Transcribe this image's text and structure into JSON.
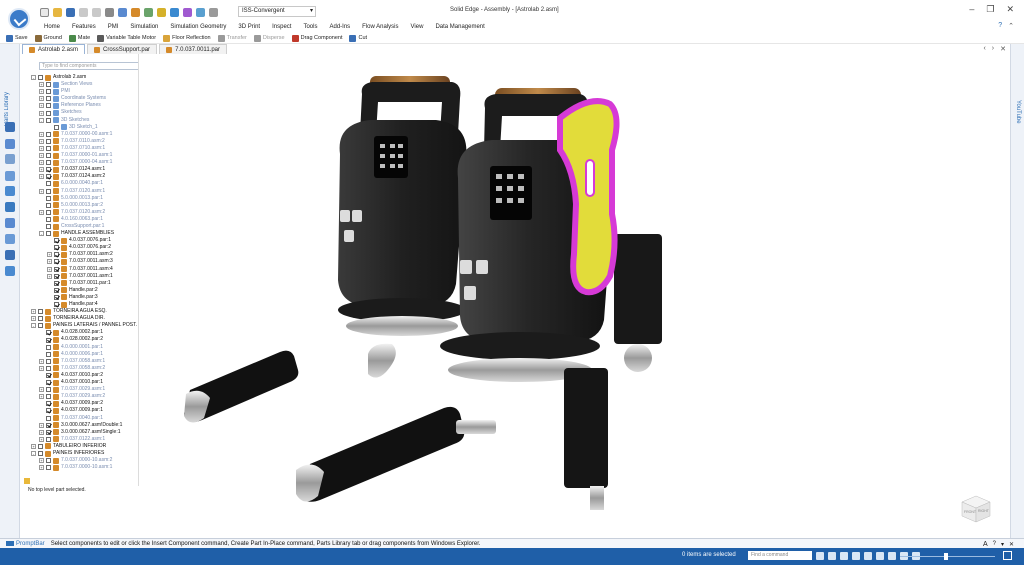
{
  "window": {
    "title": "Solid Edge - Assembly - [Astrolab 2.asm]",
    "environment": "ISS-Convergent"
  },
  "ribbon": {
    "tabs": [
      "Home",
      "Features",
      "PMI",
      "Simulation",
      "Simulation Geometry",
      "3D Print",
      "Inspect",
      "Tools",
      "Add-Ins",
      "Flow Analysis",
      "View",
      "Data Management"
    ]
  },
  "commandbar": {
    "items": [
      {
        "label": "Save",
        "color": "#3a6fb5",
        "disabled": false
      },
      {
        "label": "Ground",
        "color": "#8a6a3a",
        "disabled": false
      },
      {
        "label": "Mate",
        "color": "#4a8a4a",
        "disabled": false
      },
      {
        "label": "Variable Table Motor",
        "color": "#5a5a5a",
        "disabled": false
      },
      {
        "label": "Floor Reflection",
        "color": "#d9a43a",
        "disabled": false
      },
      {
        "label": "Transfer",
        "color": "#9a9a9a",
        "disabled": true
      },
      {
        "label": "Disperse",
        "color": "#9a9a9a",
        "disabled": true
      },
      {
        "label": "Drag Component",
        "color": "#c0392b",
        "disabled": false
      },
      {
        "label": "Cut",
        "color": "#3a6fb5",
        "disabled": false
      }
    ]
  },
  "doctabs": [
    {
      "label": "Astrolab 2.asm",
      "active": true
    },
    {
      "label": "CrossSupport.par",
      "active": false
    },
    {
      "label": "7.0.037.0011.par",
      "active": false
    }
  ],
  "sidebar": {
    "parts_library_label": "Parts Library",
    "youtube_label": "YouTube"
  },
  "pathfinder": {
    "search_placeholder": "Type to find components",
    "status": "No top level part selected.",
    "rows": [
      {
        "indent": 0,
        "exp": "-",
        "cb": false,
        "label": "Astrolab 2.asm",
        "icon": "#d58a2a",
        "style": "group"
      },
      {
        "indent": 1,
        "exp": "+",
        "cb": false,
        "label": "Section Views",
        "icon": "#6a9ad6",
        "style": "dim"
      },
      {
        "indent": 1,
        "exp": "+",
        "cb": false,
        "label": "PMI",
        "icon": "#6a9ad6",
        "style": "dim"
      },
      {
        "indent": 1,
        "exp": "+",
        "cb": false,
        "label": "Coordinate Systems",
        "icon": "#6a9ad6",
        "style": "dim"
      },
      {
        "indent": 1,
        "exp": "+",
        "cb": false,
        "label": "Reference Planes",
        "icon": "#6a9ad6",
        "style": "dim"
      },
      {
        "indent": 1,
        "exp": "+",
        "cb": false,
        "label": "Sketches",
        "icon": "#6a9ad6",
        "style": "dim"
      },
      {
        "indent": 1,
        "exp": "-",
        "cb": false,
        "label": "3D Sketches",
        "icon": "#6a9ad6",
        "style": "dim"
      },
      {
        "indent": 2,
        "exp": "",
        "cb": false,
        "label": "3D Sketch_1",
        "icon": "#6a9ad6",
        "style": "dim"
      },
      {
        "indent": 1,
        "exp": "+",
        "cb": false,
        "label": "7.0.037.0000-00.asm:1",
        "icon": "#d58a2a",
        "style": "dim"
      },
      {
        "indent": 1,
        "exp": "+",
        "cb": false,
        "label": "7.0.037.0110.asm:2",
        "icon": "#d58a2a",
        "style": "dim"
      },
      {
        "indent": 1,
        "exp": "+",
        "cb": false,
        "label": "7.0.037.0710.asm:1",
        "icon": "#d58a2a",
        "style": "dim"
      },
      {
        "indent": 1,
        "exp": "+",
        "cb": false,
        "label": "7.0.037.0000-01.asm:1",
        "icon": "#d58a2a",
        "style": "dim"
      },
      {
        "indent": 1,
        "exp": "+",
        "cb": false,
        "label": "7.0.037.0000-04.asm:1",
        "icon": "#d58a2a",
        "style": "dim"
      },
      {
        "indent": 1,
        "exp": "+",
        "cb": true,
        "label": "7.0.037.0124.asm:1",
        "icon": "#d58a2a",
        "style": "normal"
      },
      {
        "indent": 1,
        "exp": "+",
        "cb": true,
        "label": "7.0.037.0124.asm:2",
        "icon": "#d58a2a",
        "style": "normal"
      },
      {
        "indent": 1,
        "exp": "",
        "cb": false,
        "label": "6.0.000.0040.par:1",
        "icon": "#d58a2a",
        "style": "dim"
      },
      {
        "indent": 1,
        "exp": "+",
        "cb": false,
        "label": "7.0.037.0120.asm:1",
        "icon": "#d58a2a",
        "style": "dim"
      },
      {
        "indent": 1,
        "exp": "",
        "cb": false,
        "label": "5.0.000.0013.par:1",
        "icon": "#d58a2a",
        "style": "dim"
      },
      {
        "indent": 1,
        "exp": "",
        "cb": false,
        "label": "5.0.000.0013.par:2",
        "icon": "#d58a2a",
        "style": "dim"
      },
      {
        "indent": 1,
        "exp": "+",
        "cb": false,
        "label": "7.0.037.0120.asm:2",
        "icon": "#d58a2a",
        "style": "dim"
      },
      {
        "indent": 1,
        "exp": "",
        "cb": false,
        "label": "4.0.160.0063.par:1",
        "icon": "#d58a2a",
        "style": "dim"
      },
      {
        "indent": 1,
        "exp": "",
        "cb": false,
        "label": "CrossSupport.par:1",
        "icon": "#d58a2a",
        "style": "dim"
      },
      {
        "indent": 1,
        "exp": "-",
        "cb": false,
        "label": "HANDLE ASSEMBLIES",
        "icon": "#d58a2a",
        "style": "group"
      },
      {
        "indent": 2,
        "exp": "",
        "cb": true,
        "label": "4.0.037.0076.par:1",
        "icon": "#d58a2a",
        "style": "normal"
      },
      {
        "indent": 2,
        "exp": "",
        "cb": true,
        "label": "4.0.037.0076.par:2",
        "icon": "#d58a2a",
        "style": "normal"
      },
      {
        "indent": 2,
        "exp": "+",
        "cb": true,
        "label": "7.0.037.0011.asm:2",
        "icon": "#d58a2a",
        "style": "normal"
      },
      {
        "indent": 2,
        "exp": "+",
        "cb": true,
        "label": "7.0.037.0011.asm:3",
        "icon": "#d58a2a",
        "style": "normal"
      },
      {
        "indent": 2,
        "exp": "+",
        "cb": true,
        "label": "7.0.037.0011.asm:4",
        "icon": "#d58a2a",
        "style": "normal"
      },
      {
        "indent": 2,
        "exp": "+",
        "cb": true,
        "label": "7.0.037.0011.asm:1",
        "icon": "#d58a2a",
        "style": "normal"
      },
      {
        "indent": 2,
        "exp": "",
        "cb": true,
        "label": "7.0.037.0011.par:1",
        "icon": "#d58a2a",
        "style": "normal"
      },
      {
        "indent": 2,
        "exp": "",
        "cb": true,
        "label": "Handle.par:2",
        "icon": "#d58a2a",
        "style": "normal"
      },
      {
        "indent": 2,
        "exp": "",
        "cb": true,
        "label": "Handle.par:3",
        "icon": "#d58a2a",
        "style": "normal"
      },
      {
        "indent": 2,
        "exp": "",
        "cb": true,
        "label": "Handle.par:4",
        "icon": "#d58a2a",
        "style": "normal"
      },
      {
        "indent": 0,
        "exp": "+",
        "cb": false,
        "label": "TORNEIRA AGUA ESQ.",
        "icon": "#d58a2a",
        "style": "group"
      },
      {
        "indent": 0,
        "exp": "+",
        "cb": false,
        "label": "TORNEIRA AGUA DIR.",
        "icon": "#d58a2a",
        "style": "group"
      },
      {
        "indent": 0,
        "exp": "-",
        "cb": false,
        "label": "PAINEIS LATERAIS / PANNEL POST.",
        "icon": "#d58a2a",
        "style": "group"
      },
      {
        "indent": 1,
        "exp": "",
        "cb": true,
        "label": "4.0.028.0002.par:1",
        "icon": "#d58a2a",
        "style": "normal"
      },
      {
        "indent": 1,
        "exp": "",
        "cb": true,
        "label": "4.0.028.0002.par:2",
        "icon": "#d58a2a",
        "style": "normal"
      },
      {
        "indent": 1,
        "exp": "",
        "cb": false,
        "label": "4.0.000.0001.par:1",
        "icon": "#d58a2a",
        "style": "dim"
      },
      {
        "indent": 1,
        "exp": "",
        "cb": false,
        "label": "4.0.000.0006.par:1",
        "icon": "#d58a2a",
        "style": "dim"
      },
      {
        "indent": 1,
        "exp": "+",
        "cb": false,
        "label": "7.0.037.0058.asm:1",
        "icon": "#d58a2a",
        "style": "dim"
      },
      {
        "indent": 1,
        "exp": "+",
        "cb": false,
        "label": "7.0.037.0058.asm:2",
        "icon": "#d58a2a",
        "style": "dim"
      },
      {
        "indent": 1,
        "exp": "",
        "cb": true,
        "label": "4.0.037.0010.par:2",
        "icon": "#d58a2a",
        "style": "normal"
      },
      {
        "indent": 1,
        "exp": "",
        "cb": true,
        "label": "4.0.037.0010.par:1",
        "icon": "#d58a2a",
        "style": "normal"
      },
      {
        "indent": 1,
        "exp": "+",
        "cb": false,
        "label": "7.0.037.0029.asm:1",
        "icon": "#d58a2a",
        "style": "dim"
      },
      {
        "indent": 1,
        "exp": "+",
        "cb": false,
        "label": "7.0.037.0029.asm:2",
        "icon": "#d58a2a",
        "style": "dim"
      },
      {
        "indent": 1,
        "exp": "",
        "cb": true,
        "label": "4.0.037.0009.par:2",
        "icon": "#d58a2a",
        "style": "normal"
      },
      {
        "indent": 1,
        "exp": "",
        "cb": true,
        "label": "4.0.037.0009.par:1",
        "icon": "#d58a2a",
        "style": "normal"
      },
      {
        "indent": 1,
        "exp": "",
        "cb": false,
        "label": "7.0.037.0040.par:1",
        "icon": "#d58a2a",
        "style": "dim"
      },
      {
        "indent": 1,
        "exp": "+",
        "cb": true,
        "label": "3.0.000.0627.asm!Double:1",
        "icon": "#d58a2a",
        "style": "normal"
      },
      {
        "indent": 1,
        "exp": "+",
        "cb": true,
        "label": "3.0.000.0627.asm!Single:1",
        "icon": "#d58a2a",
        "style": "normal"
      },
      {
        "indent": 1,
        "exp": "+",
        "cb": false,
        "label": "7.0.037.0122.asm:1",
        "icon": "#d58a2a",
        "style": "dim"
      },
      {
        "indent": 0,
        "exp": "+",
        "cb": false,
        "label": "TABULEIRO INFERIOR",
        "icon": "#d58a2a",
        "style": "group"
      },
      {
        "indent": 0,
        "exp": "-",
        "cb": false,
        "label": "PAINEIS INFERIORES",
        "icon": "#d58a2a",
        "style": "group"
      },
      {
        "indent": 1,
        "exp": "+",
        "cb": false,
        "label": "7.0.037.0000-10.asm:2",
        "icon": "#d58a2a",
        "style": "dim"
      },
      {
        "indent": 1,
        "exp": "+",
        "cb": false,
        "label": "7.0.037.0000-10.asm:1",
        "icon": "#d58a2a",
        "style": "dim"
      }
    ]
  },
  "viewcube": {
    "face_front": "FRONT",
    "face_right": "RIGHT"
  },
  "promptbar": {
    "label": "PromptBar",
    "message": "Select components to edit or click the Insert Component command, Create Part In-Place command, Parts Library tab or drag components from Windows Explorer."
  },
  "statusbar": {
    "items_selected": "0 items are selected",
    "find_placeholder": "Find a command"
  },
  "colors": {
    "accent": "#1f5fa8",
    "handle_highlight": "#d63ad6",
    "handle_yellow": "#e2dc3a",
    "wood": "#b07a3a"
  }
}
